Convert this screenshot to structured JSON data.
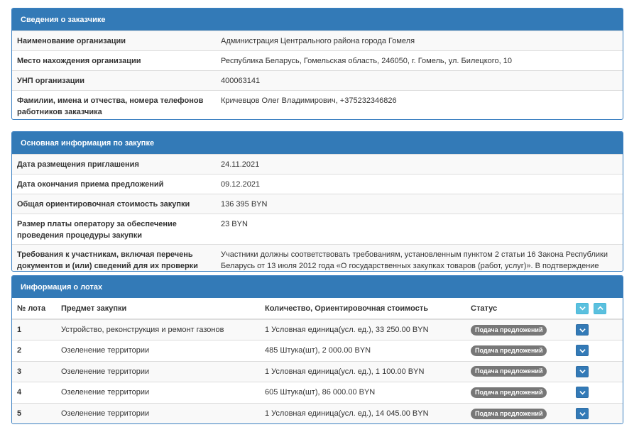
{
  "customer": {
    "title": "Сведения о заказчике",
    "rows": [
      {
        "key": "Наименование организации",
        "value": "Администрация Центрального района города Гомеля"
      },
      {
        "key": "Место нахождения организации",
        "value": "Республика Беларусь, Гомельская область, 246050, г. Гомель, ул. Билецкого, 10"
      },
      {
        "key": "УНП организации",
        "value": "400063141"
      },
      {
        "key": "Фамилии, имена и отчества, номера телефонов работников заказчика",
        "value": "Кричевцов Олег Владимирович, +375232346826"
      }
    ]
  },
  "purchase": {
    "title": "Основная информация по закупке",
    "rows": [
      {
        "key": "Дата размещения приглашения",
        "value": "24.11.2021"
      },
      {
        "key": "Дата окончания приема предложений",
        "value": "09.12.2021"
      },
      {
        "key": "Общая ориентировочная стоимость закупки",
        "value": "136 395 BYN"
      },
      {
        "key": "Размер платы оператору за обеспечение проведения процедуры закупки",
        "value": "23 BYN"
      },
      {
        "key": "Требования к участникам, включая перечень документов и (или) сведений для их проверки",
        "value": "Участники должны соответствовать требованиям, установленным пунктом 2 статьи 16 Закона Республики Беларусь от 13 июля 2012 года «О государственных закупках товаров (работ, услуг)». В подтверждение"
      }
    ]
  },
  "lots": {
    "title": "Информация о лотах",
    "headers": {
      "num": "№ лота",
      "subject": "Предмет закупки",
      "qty": "Количество, Ориентировочная стоимость",
      "status": "Статус"
    },
    "rows": [
      {
        "num": "1",
        "subject": "Устройство, реконструкция и ремонт газонов",
        "qty": "1 Условная единица(усл. ед.), 33 250.00 BYN",
        "status": "Подача предложений"
      },
      {
        "num": "2",
        "subject": "Озеленение территории",
        "qty": "485 Штука(шт), 2 000.00 BYN",
        "status": "Подача предложений"
      },
      {
        "num": "3",
        "subject": "Озеленение территории",
        "qty": "1 Условная единица(усл. ед.), 1 100.00 BYN",
        "status": "Подача предложений"
      },
      {
        "num": "4",
        "subject": "Озеленение территории",
        "qty": "605 Штука(шт), 86 000.00 BYN",
        "status": "Подача предложений"
      },
      {
        "num": "5",
        "subject": "Озеленение территории",
        "qty": "1 Условная единица(усл. ед.), 14 045.00 BYN",
        "status": "Подача предложений"
      }
    ],
    "icons": {
      "expand_all": "chevron-down-icon",
      "collapse_all": "chevron-up-icon",
      "row_toggle": "chevron-down-icon"
    }
  },
  "colors": {
    "panel_header": "#337ab7",
    "badge": "#777777",
    "button_light": "#5bc0de"
  }
}
